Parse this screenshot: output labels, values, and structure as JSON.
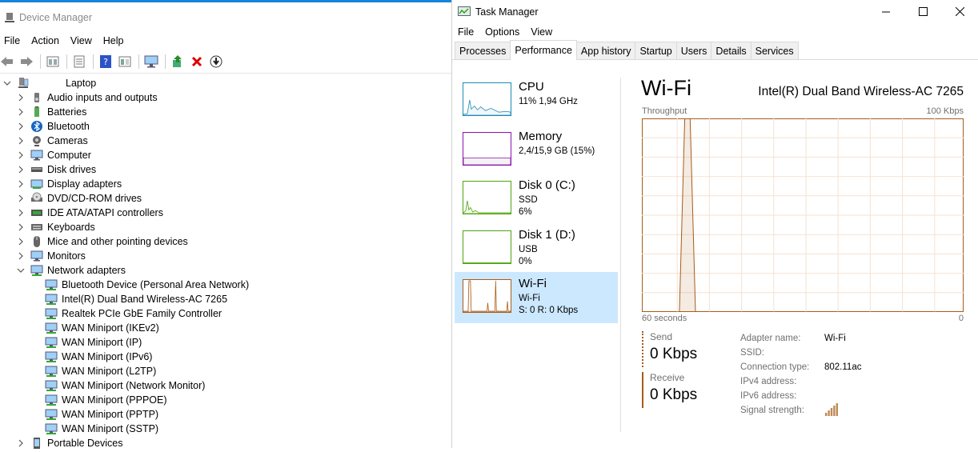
{
  "device_manager": {
    "title": "Device Manager",
    "menu": [
      "File",
      "Action",
      "View",
      "Help"
    ],
    "toolbar_icons": [
      "back-icon",
      "forward-icon",
      "properties-icon",
      "list-icon",
      "help-icon",
      "resources-icon",
      "monitor-icon",
      "update-driver-icon",
      "uninstall-icon",
      "download-icon"
    ],
    "tree": [
      {
        "label": "Laptop",
        "indent": 0,
        "exp": "open",
        "icon": "computer"
      },
      {
        "label": "Audio inputs and outputs",
        "indent": 1,
        "exp": "closed",
        "icon": "audio"
      },
      {
        "label": "Batteries",
        "indent": 1,
        "exp": "closed",
        "icon": "battery"
      },
      {
        "label": "Bluetooth",
        "indent": 1,
        "exp": "closed",
        "icon": "bluetooth"
      },
      {
        "label": "Cameras",
        "indent": 1,
        "exp": "closed",
        "icon": "camera"
      },
      {
        "label": "Computer",
        "indent": 1,
        "exp": "closed",
        "icon": "monitor"
      },
      {
        "label": "Disk drives",
        "indent": 1,
        "exp": "closed",
        "icon": "disk"
      },
      {
        "label": "Display adapters",
        "indent": 1,
        "exp": "closed",
        "icon": "display"
      },
      {
        "label": "DVD/CD-ROM drives",
        "indent": 1,
        "exp": "closed",
        "icon": "dvd"
      },
      {
        "label": "IDE ATA/ATAPI controllers",
        "indent": 1,
        "exp": "closed",
        "icon": "ide"
      },
      {
        "label": "Keyboards",
        "indent": 1,
        "exp": "closed",
        "icon": "keyboard"
      },
      {
        "label": "Mice and other pointing devices",
        "indent": 1,
        "exp": "closed",
        "icon": "mouse"
      },
      {
        "label": "Monitors",
        "indent": 1,
        "exp": "closed",
        "icon": "monitor"
      },
      {
        "label": "Network adapters",
        "indent": 1,
        "exp": "open",
        "icon": "network"
      },
      {
        "label": "Bluetooth Device (Personal Area Network)",
        "indent": 2,
        "exp": "none",
        "icon": "network"
      },
      {
        "label": "Intel(R) Dual Band Wireless-AC 7265",
        "indent": 2,
        "exp": "none",
        "icon": "network"
      },
      {
        "label": "Realtek PCIe GbE Family Controller",
        "indent": 2,
        "exp": "none",
        "icon": "network"
      },
      {
        "label": "WAN Miniport (IKEv2)",
        "indent": 2,
        "exp": "none",
        "icon": "network"
      },
      {
        "label": "WAN Miniport (IP)",
        "indent": 2,
        "exp": "none",
        "icon": "network"
      },
      {
        "label": "WAN Miniport (IPv6)",
        "indent": 2,
        "exp": "none",
        "icon": "network"
      },
      {
        "label": "WAN Miniport (L2TP)",
        "indent": 2,
        "exp": "none",
        "icon": "network"
      },
      {
        "label": "WAN Miniport (Network Monitor)",
        "indent": 2,
        "exp": "none",
        "icon": "network"
      },
      {
        "label": "WAN Miniport (PPPOE)",
        "indent": 2,
        "exp": "none",
        "icon": "network"
      },
      {
        "label": "WAN Miniport (PPTP)",
        "indent": 2,
        "exp": "none",
        "icon": "network"
      },
      {
        "label": "WAN Miniport (SSTP)",
        "indent": 2,
        "exp": "none",
        "icon": "network"
      },
      {
        "label": "Portable Devices",
        "indent": 1,
        "exp": "closed",
        "icon": "portable"
      }
    ]
  },
  "task_manager": {
    "title": "Task Manager",
    "menu": [
      "File",
      "Options",
      "View"
    ],
    "tabs": [
      {
        "label": "Processes",
        "active": false
      },
      {
        "label": "Performance",
        "active": true
      },
      {
        "label": "App history",
        "active": false
      },
      {
        "label": "Startup",
        "active": false
      },
      {
        "label": "Users",
        "active": false
      },
      {
        "label": "Details",
        "active": false
      },
      {
        "label": "Services",
        "active": false
      }
    ],
    "resources": [
      {
        "name": "CPU",
        "line1": "11% 1,94 GHz",
        "line2": "",
        "color": "#1a8cb3",
        "fill": "#f1f6fa",
        "selected": false
      },
      {
        "name": "Memory",
        "line1": "2,4/15,9 GB (15%)",
        "line2": "",
        "color": "#8b12ae",
        "fill": "#f4f2f4",
        "selected": false
      },
      {
        "name": "Disk 0 (C:)",
        "line1": "SSD",
        "line2": "6%",
        "color": "#4da60c",
        "fill": "#eff7ea",
        "selected": false
      },
      {
        "name": "Disk 1 (D:)",
        "line1": "USB",
        "line2": "0%",
        "color": "#4da60c",
        "fill": "#eff7ea",
        "selected": false
      },
      {
        "name": "Wi-Fi",
        "line1": "Wi-Fi",
        "line2": "S: 0 R: 0 Kbps",
        "color": "#a65c1a",
        "fill": "#fcf3eb",
        "selected": true
      }
    ],
    "detail": {
      "title": "Wi-Fi",
      "adapter": "Intel(R) Dual Band Wireless-AC 7265",
      "throughput_label": "Throughput",
      "max_label": "100 Kbps",
      "x_left": "60 seconds",
      "x_right": "0",
      "send_label": "Send",
      "send_value": "0 Kbps",
      "receive_label": "Receive",
      "receive_value": "0 Kbps",
      "props": [
        {
          "k": "Adapter name:",
          "v": "Wi-Fi"
        },
        {
          "k": "SSID:",
          "v": ""
        },
        {
          "k": "Connection type:",
          "v": "802.11ac"
        },
        {
          "k": "IPv4 address:",
          "v": ""
        },
        {
          "k": "IPv6 address:",
          "v": ""
        },
        {
          "k": "Signal strength:",
          "v": ""
        }
      ],
      "signal_bars_filled": 5,
      "signal_bars_total": 5
    }
  },
  "chart_data": {
    "type": "area",
    "ylabel": "Throughput",
    "ylim": [
      0,
      100
    ],
    "x_seconds_ago": [
      60,
      59,
      58,
      57,
      56,
      55,
      54,
      53,
      52,
      51,
      50,
      49,
      48,
      47,
      46,
      45,
      44,
      43,
      42,
      41,
      40,
      39,
      38,
      37,
      36,
      35,
      34,
      33,
      32,
      31,
      30,
      29,
      28,
      27,
      26,
      25,
      24,
      23,
      22,
      21,
      20,
      19,
      18,
      17,
      16,
      15,
      14,
      13,
      12,
      11,
      10,
      9,
      8,
      7,
      6,
      5,
      4,
      3,
      2,
      1,
      0
    ],
    "series": [
      {
        "values": [
          0,
          0,
          0,
          0,
          0,
          0,
          0,
          0,
          100,
          100,
          0,
          0,
          0,
          0,
          0,
          0,
          0,
          0,
          0,
          0,
          0,
          0,
          0,
          0,
          0,
          0,
          0,
          0,
          0,
          0,
          0,
          0,
          0,
          0,
          0,
          0,
          0,
          0,
          0,
          0,
          0,
          0,
          0,
          0,
          0,
          0,
          0,
          0,
          0,
          0,
          0,
          0,
          0,
          0,
          0,
          0,
          0,
          0,
          0,
          0,
          0
        ]
      },
      {
        "values": [
          0,
          0,
          0,
          0,
          0,
          0,
          0,
          0,
          0,
          0,
          0,
          0,
          0,
          0,
          0,
          0,
          0,
          0,
          0,
          0,
          0,
          0,
          0,
          0,
          0,
          0,
          0,
          0,
          0,
          0,
          0,
          0,
          0,
          0,
          0,
          0,
          0,
          0,
          0,
          0,
          0,
          0,
          0,
          0,
          0,
          0,
          0,
          0,
          0,
          0,
          0,
          0,
          0,
          0,
          0,
          0,
          0,
          0,
          0,
          0,
          0
        ]
      }
    ]
  }
}
